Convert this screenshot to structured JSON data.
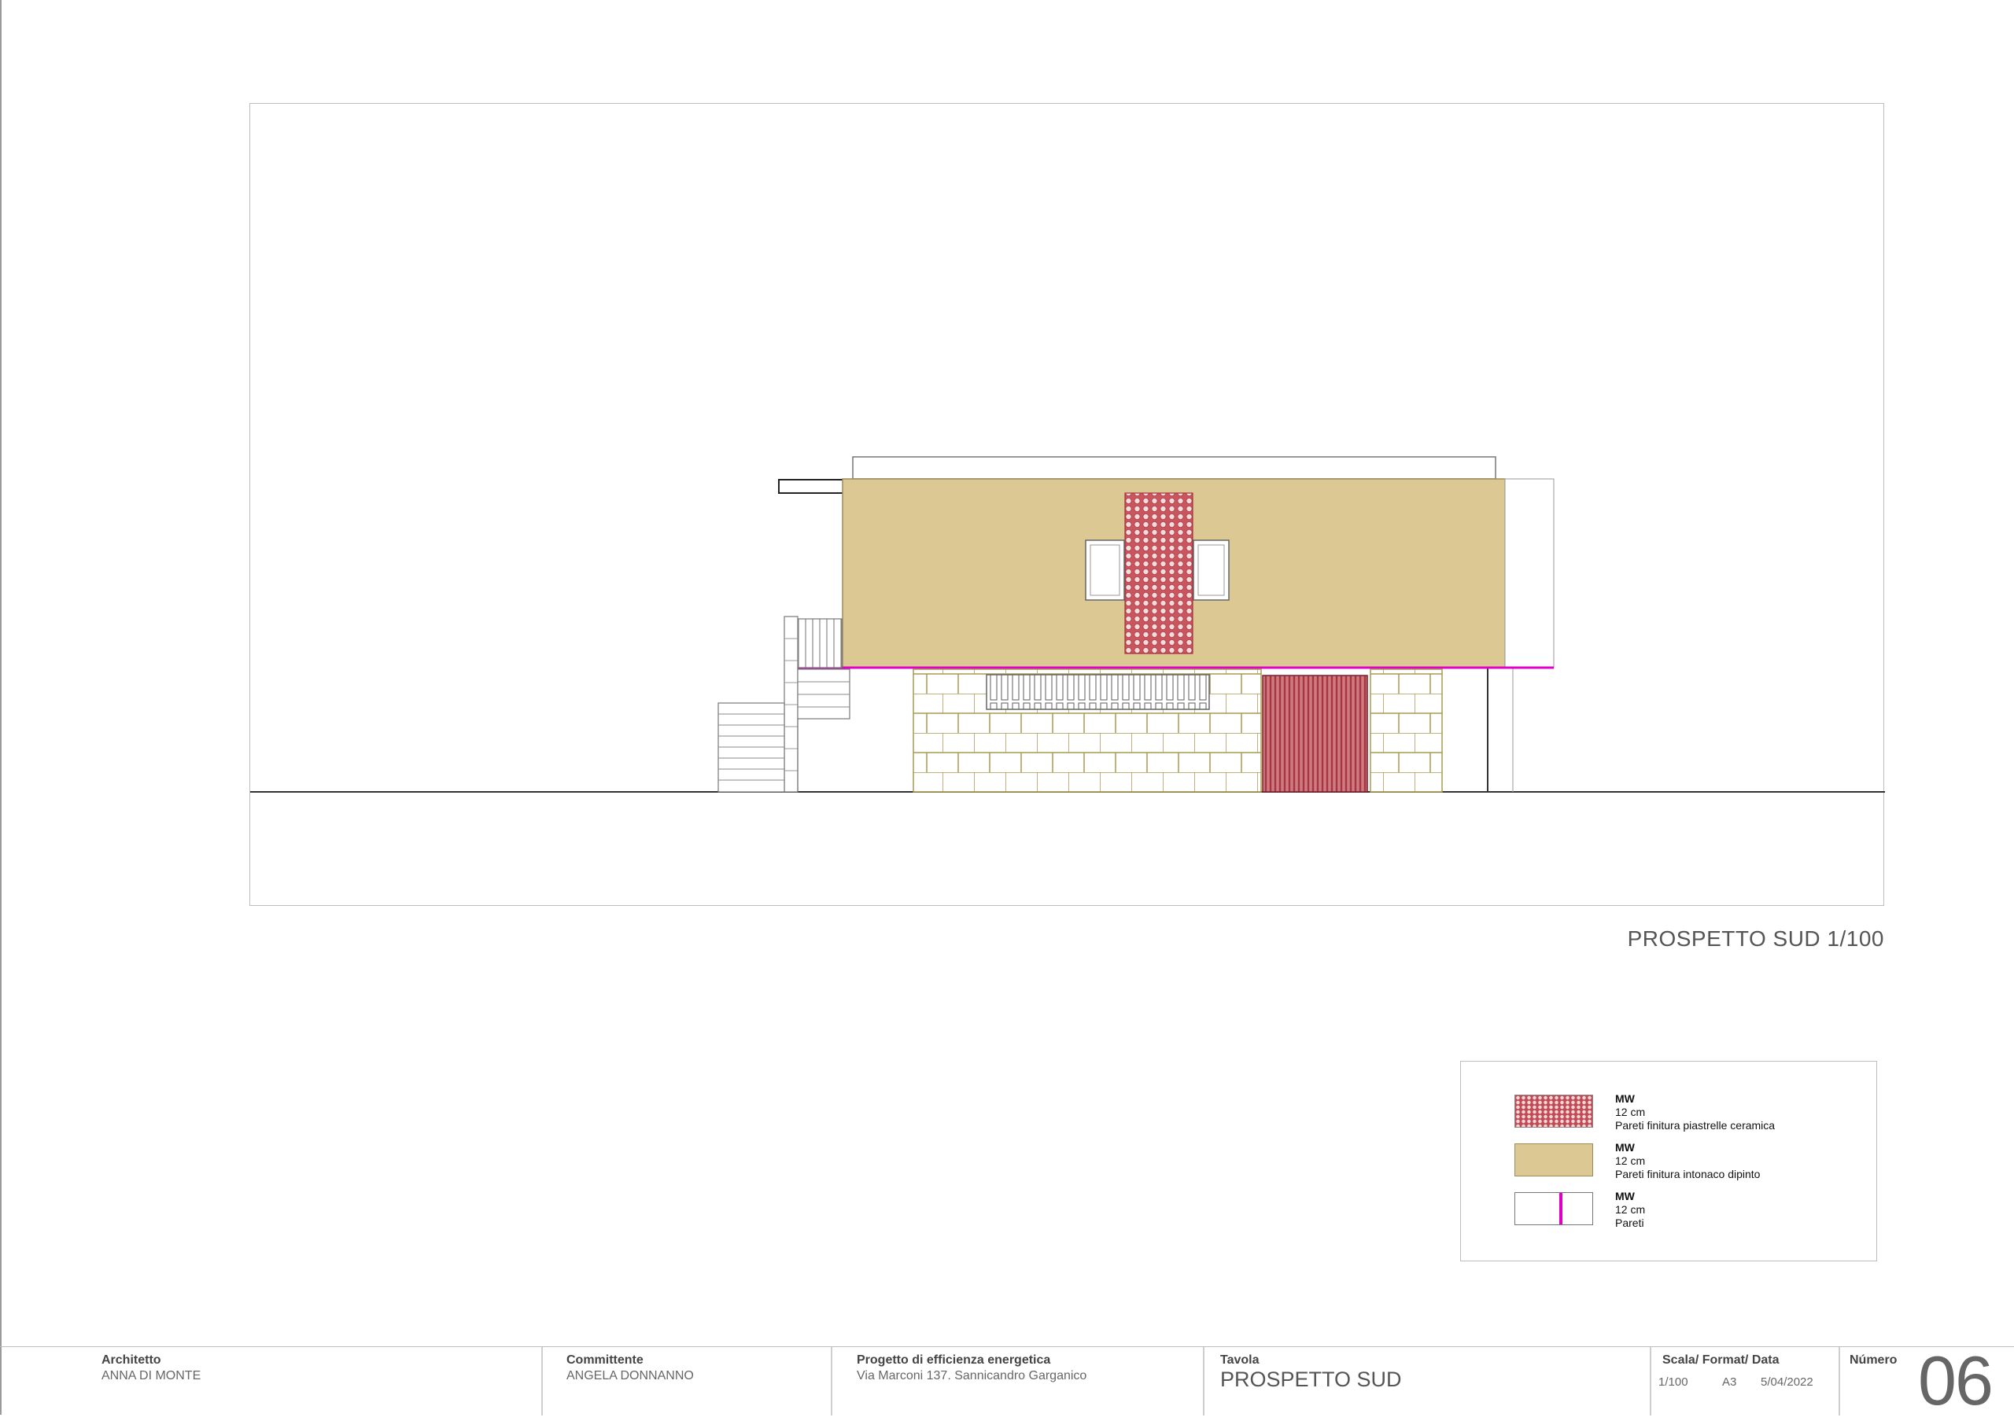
{
  "view_title": "PROSPETTO SUD 1/100",
  "colors": {
    "plaster": "#dcc892",
    "ceramic": "#c14a55",
    "wall_line": "#e000c8",
    "stone_line": "#a79a52"
  },
  "legend": {
    "items": [
      {
        "code": "MW",
        "thickness": "12 cm",
        "description": "Pareti finitura piastrelle ceramica",
        "swatch": "ceramic-hex-pattern"
      },
      {
        "code": "MW",
        "thickness": "12 cm",
        "description": "Pareti finitura intonaco dipinto",
        "swatch": "painted-plaster"
      },
      {
        "code": "MW",
        "thickness": "12 cm",
        "description": "Pareti",
        "swatch": "magenta-wall-line"
      }
    ]
  },
  "title_block": {
    "architect_label": "Architetto",
    "architect_value": "ANNA DI MONTE",
    "client_label": "Committente",
    "client_value": "ANGELA DONNANNO",
    "project_label": "Progetto di efficienza energetica",
    "project_value": "Via Marconi 137. Sannicandro Garganico",
    "sheet_label": "Tavola",
    "sheet_value": "PROSPETTO SUD",
    "meta_label": "Scala/ Format/ Data",
    "scale": "1/100",
    "format": "A3",
    "date": "5/04/2022",
    "number_label": "Número",
    "number": "06"
  }
}
